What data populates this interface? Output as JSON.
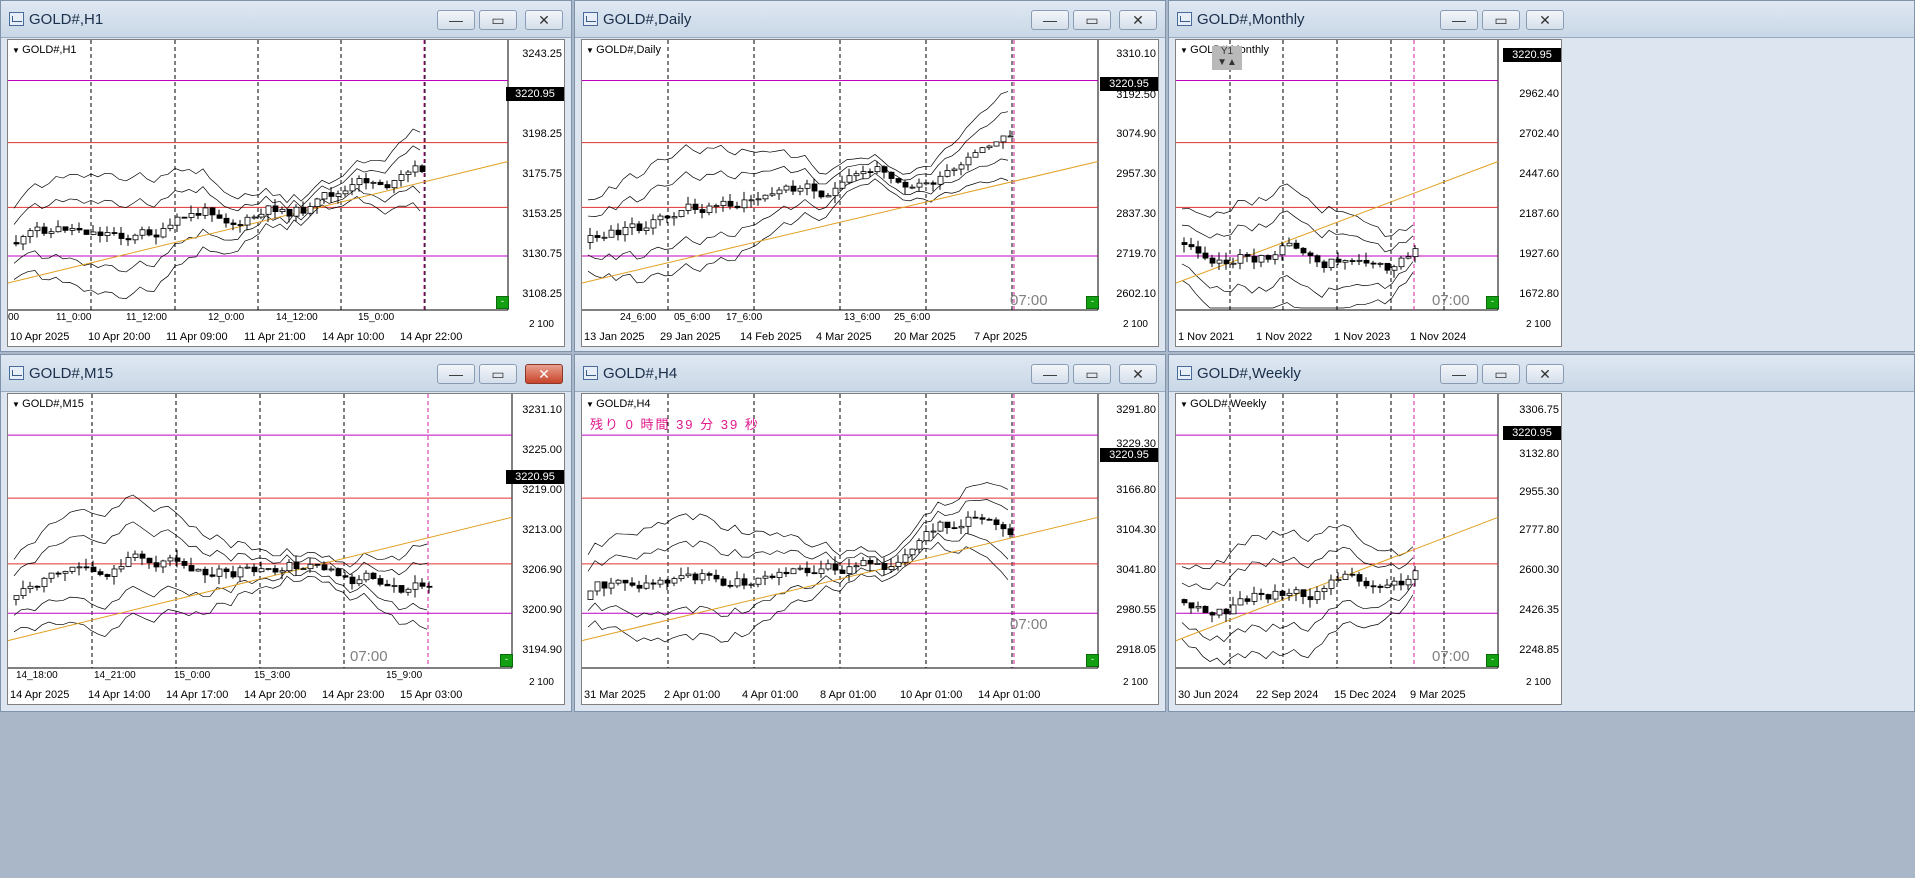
{
  "windows": {
    "h1": {
      "title": "GOLD#,H1",
      "symbol": "GOLD#,H1",
      "prices": [
        "3243.25",
        "3220.95",
        "3198.25",
        "3175.75",
        "3153.25",
        "3130.75",
        "3108.25"
      ],
      "current": "3220.95",
      "sessions": [
        "00",
        "11_0:00",
        "11_12:00",
        "12_0:00",
        "14_12:00",
        "15_0:00"
      ],
      "times": [
        "10 Apr 2025",
        "10 Apr 20:00",
        "11 Apr 09:00",
        "11 Apr 21:00",
        "14 Apr 10:00",
        "14 Apr 22:00"
      ],
      "corner": "2\n100"
    },
    "daily": {
      "title": "GOLD#,Daily",
      "symbol": "GOLD#,Daily",
      "prices": [
        "3310.10",
        "3192.50",
        "3074.90",
        "2957.30",
        "2837.30",
        "2719.70",
        "2602.10"
      ],
      "current": "3220.95",
      "sessions": [
        "24_6:00",
        "05_6:00",
        "17_6:00",
        "13_6:00",
        "25_6:00"
      ],
      "times": [
        "13 Jan 2025",
        "29 Jan 2025",
        "14 Feb 2025",
        "4 Mar 2025",
        "20 Mar 2025",
        "7 Apr 2025"
      ],
      "hour": "07:00",
      "corner": "2\n100"
    },
    "monthly": {
      "title": "GOLD#,Monthly",
      "symbol": "GOLD#,Monthly",
      "y1": "Y1",
      "prices": [
        "2962.40",
        "2702.40",
        "2447.60",
        "2187.60",
        "1927.60",
        "1672.80"
      ],
      "current": "3220.95",
      "times": [
        "1 Nov 2021",
        "1 Nov 2022",
        "1 Nov 2023",
        "1 Nov 2024"
      ],
      "hour": "07:00",
      "corner": "2\n100"
    },
    "m15": {
      "title": "GOLD#,M15",
      "symbol": "GOLD#,M15",
      "prices": [
        "3231.10",
        "3225.00",
        "3219.00",
        "3213.00",
        "3206.90",
        "3200.90",
        "3194.90"
      ],
      "current": "3220.95",
      "sessions": [
        "14_18:00",
        "14_21:00",
        "15_0:00",
        "15_3:00",
        "15_9:00"
      ],
      "times": [
        "14 Apr 2025",
        "14 Apr 14:00",
        "14 Apr 17:00",
        "14 Apr 20:00",
        "14 Apr 23:00",
        "15 Apr 03:00"
      ],
      "hour": "07:00",
      "corner": "2\n100"
    },
    "h4": {
      "title": "GOLD#,H4",
      "symbol": "GOLD#,H4",
      "countdown": "残り 0 時間 39 分 39 秒",
      "prices": [
        "3291.80",
        "3229.30",
        "3166.80",
        "3104.30",
        "3041.80",
        "2980.55",
        "2918.05"
      ],
      "current": "3220.95",
      "times": [
        "31 Mar 2025",
        "2 Apr 01:00",
        "4 Apr 01:00",
        "8 Apr 01:00",
        "10 Apr 01:00",
        "14 Apr 01:00"
      ],
      "hour": "07:00",
      "corner": "2\n100"
    },
    "weekly": {
      "title": "GOLD#,Weekly",
      "symbol": "GOLD#,Weekly",
      "prices": [
        "3306.75",
        "3132.80",
        "2955.30",
        "2777.80",
        "2600.30",
        "2426.35",
        "2248.85"
      ],
      "current": "3220.95",
      "times": [
        "30 Jun 2024",
        "22 Sep 2024",
        "15 Dec 2024",
        "9 Mar 2025"
      ],
      "hour": "07:00",
      "corner": "2\n100"
    }
  },
  "buttons": {
    "min": "—",
    "max": "▭",
    "close": "✕"
  },
  "colors": {
    "bull": "#ffffff",
    "bear": "#000000",
    "magenta": "#c000c0",
    "red": "#e03030",
    "blue": "#3060d0",
    "orange": "#e0a020",
    "cyan": "#1ea0d8",
    "green": "#12a012"
  }
}
